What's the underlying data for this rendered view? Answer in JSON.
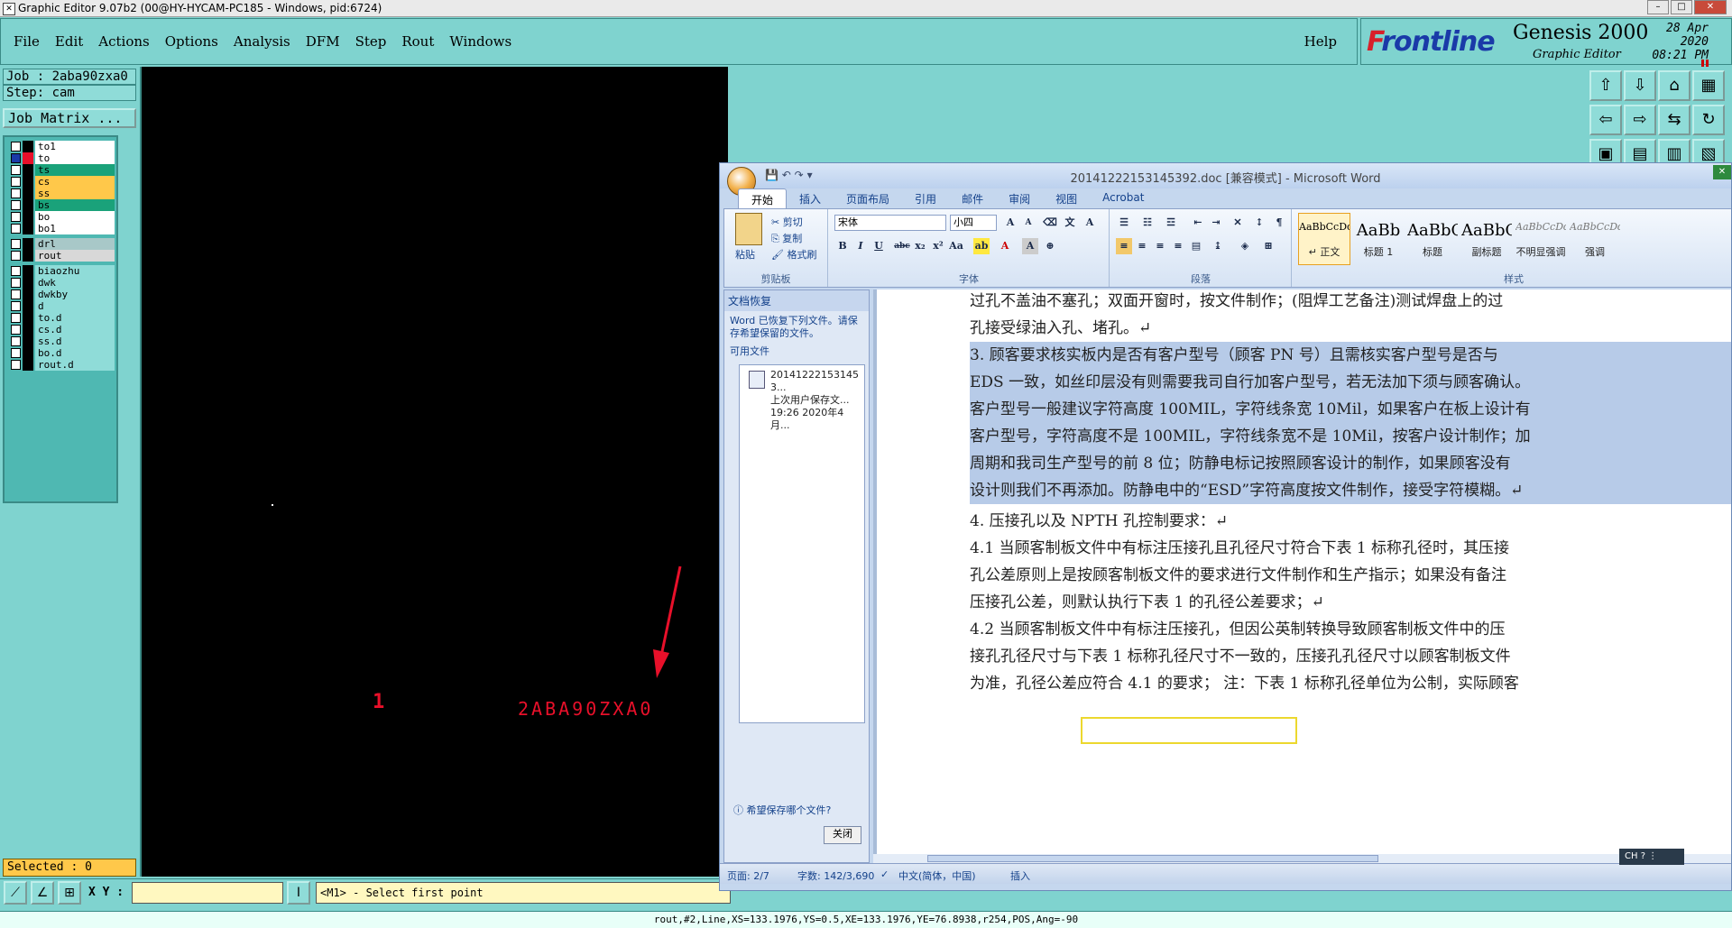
{
  "window": {
    "title": "Graphic Editor 9.07b2 (00@HY-HYCAM-PC185 - Windows, pid:6724)"
  },
  "menu": {
    "items": [
      "File",
      "Edit",
      "Actions",
      "Options",
      "Analysis",
      "DFM",
      "Step",
      "Rout",
      "Windows"
    ],
    "help": "Help"
  },
  "brand": {
    "logo_f": "F",
    "logo_rest": "rontline",
    "product": "Genesis 2000",
    "subtitle": "Graphic Editor",
    "date": "28 Apr 2020",
    "time": "08:21 PM",
    "logo_color": "#d8202a",
    "text_color": "#1a3aa8"
  },
  "job": {
    "name": "Job : 2aba90zxa0",
    "step": "Step: cam",
    "matrix_button": "Job Matrix ..."
  },
  "layers": [
    {
      "name": "to1",
      "swatch": "#000000",
      "bg": "#ffffff",
      "active": false
    },
    {
      "name": "to",
      "swatch": "#e8102a",
      "bg": "#ffffff",
      "active": true
    },
    {
      "name": "ts",
      "swatch": "#000000",
      "bg": "#1aa27a",
      "active": false
    },
    {
      "name": "cs",
      "swatch": "#000000",
      "bg": "#ffc84a",
      "active": false
    },
    {
      "name": "ss",
      "swatch": "#000000",
      "bg": "#ffc84a",
      "active": false
    },
    {
      "name": "bs",
      "swatch": "#000000",
      "bg": "#1aa27a",
      "active": false
    },
    {
      "name": "bo",
      "swatch": "#000000",
      "bg": "#ffffff",
      "active": false
    },
    {
      "name": "bo1",
      "swatch": "#000000",
      "bg": "#ffffff",
      "active": false
    },
    {
      "name": "drl",
      "swatch": "#000000",
      "bg": "#a8c8c8",
      "active": false
    },
    {
      "name": "rout",
      "swatch": "#000000",
      "bg": "#d8d8d8",
      "active": false
    },
    {
      "name": "biaozhu",
      "swatch": "#000000",
      "bg": "#8fdcd8",
      "active": false
    },
    {
      "name": "dwk",
      "swatch": "#000000",
      "bg": "#8fdcd8",
      "active": false
    },
    {
      "name": "dwkby",
      "swatch": "#000000",
      "bg": "#8fdcd8",
      "active": false
    },
    {
      "name": "d",
      "swatch": "#000000",
      "bg": "#8fdcd8",
      "active": false
    },
    {
      "name": "to.d",
      "swatch": "#000000",
      "bg": "#8fdcd8",
      "active": false
    },
    {
      "name": "cs.d",
      "swatch": "#000000",
      "bg": "#8fdcd8",
      "active": false
    },
    {
      "name": "ss.d",
      "swatch": "#000000",
      "bg": "#8fdcd8",
      "active": false
    },
    {
      "name": "bo.d",
      "swatch": "#000000",
      "bg": "#8fdcd8",
      "active": false
    },
    {
      "name": "rout.d",
      "swatch": "#000000",
      "bg": "#8fdcd8",
      "active": false
    }
  ],
  "selected": "Selected : 0",
  "canvas": {
    "label_1": "1",
    "label_job": "2ABA90ZXA0",
    "mark_color": "#e8102a"
  },
  "bottom": {
    "xy_label": "X Y :",
    "xy_value": "",
    "prompt": "<M1> - Select first point"
  },
  "status": "rout,#2,Line,XS=133.1976,YS=0.5,XE=133.1976,YE=76.8938,r254,POS,Ang=-90",
  "word": {
    "title": "20141222153145392.doc [兼容模式] - Microsoft Word",
    "tabs": [
      "开始",
      "插入",
      "页面布局",
      "引用",
      "邮件",
      "审阅",
      "视图",
      "Acrobat"
    ],
    "clipboard": {
      "paste": "粘贴",
      "cut": "剪切",
      "copy": "复制",
      "format_painter": "格式刷",
      "label": "剪贴板"
    },
    "font": {
      "name": "宋体",
      "size": "小四",
      "label": "字体"
    },
    "paragraph": {
      "label": "段落"
    },
    "styles": {
      "label": "样式",
      "items": [
        {
          "preview": "AaBbCcDd",
          "name": "↵ 正文"
        },
        {
          "preview": "AaBb",
          "name": "标题 1"
        },
        {
          "preview": "AaBbC",
          "name": "标题"
        },
        {
          "preview": "AaBbC",
          "name": "副标题"
        },
        {
          "preview": "AaBbCcDd",
          "name": "不明显强调"
        },
        {
          "preview": "AaBbCcDd",
          "name": "强调"
        }
      ]
    },
    "recovery": {
      "header": "文档恢复",
      "desc": "Word 已恢复下列文件。请保存希望保留的文件。",
      "available": "可用文件",
      "file_line1": "20141222153145​3...",
      "file_line2": "上次用户保存文...",
      "file_line3": "19:26 2020年4月...",
      "ask": "哪个文件?",
      "ask_full": "希望保存哪个文件?",
      "close": "关闭"
    },
    "doc_lines": [
      "过孔不盖油不塞孔；双面开窗时，按文件制作；(阻焊工艺备注)测试焊盘上的过",
      "孔接受绿油入孔、堵孔。↵",
      "3.  顾客要求核实板内是否有客户型号（顾客 PN 号）且需核实客户型号是否与",
      "EDS 一致，如丝印层没有则需要我司自行加客户型号，若无法加下须与顾客确认。",
      "客户型号一般建议字符高度 100MIL，字符线条宽 10Mil，如果客户在板上设计有",
      "客户型号，字符高度不是 100MIL，字符线条宽不是 10Mil，按客户设计制作；加",
      "周期和我司生产型号的前 8 位；防静电标记按照顾客设计的制作，如果顾客没有",
      "设计则我们不再添加。防静电中的“ESD”字符高度按文件制作，接受字符模糊。↵",
      "4.  压接孔以及 NPTH 孔控制要求：↵",
      "4.1 当顾客制板文件中有标注压接孔且孔径尺寸符合下表 1 标称孔径时，其压接",
      "孔公差原则上是按顾客制板文件的要求进行文件制作和生产指示；如果没有备注",
      "压接孔公差，则默认执行下表 1 的孔径公差要求；↵",
      "4.2  当顾客制板文件中有标注压接孔，但因公英制转换导致顾客制板文件中的压",
      "接孔孔径尺寸与下表 1 标称孔径尺寸不一致的，压接孔孔径尺寸以顾客制板文件",
      "为准，孔径公差应符合 4.1 的要求；  注：下表 1 标称孔径单位为公制，实际顾客"
    ],
    "status": {
      "page": "页面: 2/7",
      "words": "字数: 142/3,690",
      "lang": "中文(简体，中国)",
      "mode": "插入"
    },
    "ime": "CH"
  }
}
